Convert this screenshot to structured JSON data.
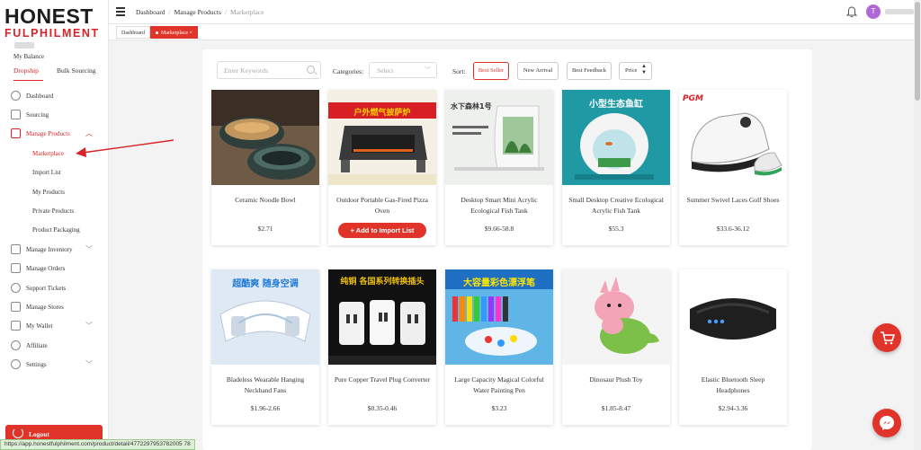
{
  "brand": {
    "line1": "HONEST",
    "line2": "FULPHILMENT"
  },
  "sidebar": {
    "balance_label": "My Balance",
    "tabs": [
      "Dropship",
      "Bulk Sourcing"
    ],
    "items": [
      {
        "label": "Dashboard",
        "icon": "dashboard-icon"
      },
      {
        "label": "Sourcing",
        "icon": "sourcing-icon"
      },
      {
        "label": "Manage Products",
        "icon": "products-icon"
      },
      {
        "label": "Manage Inventory",
        "icon": "inventory-icon"
      },
      {
        "label": "Manage Orders",
        "icon": "orders-icon"
      },
      {
        "label": "Support Tickets",
        "icon": "support-icon"
      },
      {
        "label": "Manage Stores",
        "icon": "stores-icon"
      },
      {
        "label": "My Wallet",
        "icon": "wallet-icon"
      },
      {
        "label": "Affiliate",
        "icon": "affiliate-icon"
      },
      {
        "label": "Settings",
        "icon": "settings-icon"
      }
    ],
    "subitems": [
      "Marketplace",
      "Import List",
      "My Products",
      "Private Products",
      "Product Packaging"
    ],
    "logout": "Logout"
  },
  "topbar": {
    "breadcrumbs": [
      "Dashboard",
      "Manage Products",
      "Marketplace"
    ],
    "avatar_initial": "T"
  },
  "page_tabs": [
    "Dashboard",
    "Marketplace"
  ],
  "filters": {
    "search_placeholder": "Enter Keywords",
    "categories_label": "Categories:",
    "categories_placeholder": "Select",
    "sort_label": "Sort:",
    "sort_options": [
      "Best Seller",
      "New Arrival",
      "Best Feedback",
      "Price"
    ],
    "active_sort": "Best Seller"
  },
  "products": [
    {
      "name": "Ceramic Noodle Bowl",
      "price": "$2.71"
    },
    {
      "name": "Outdoor Portable Gas-Fired Pizza Oven",
      "price": "",
      "banner": "户外燃气披萨炉"
    },
    {
      "name": "Desktop Smart Mini Acrylic Ecological Fish Tank",
      "price": "$9.66-58.8",
      "banner": "水下森林1号"
    },
    {
      "name": "Small Desktop Creative Ecological Acrylic Fish Tank",
      "price": "$55.3",
      "banner": "小型生态鱼缸"
    },
    {
      "name": "Summer Swivel Laces Golf Shoes",
      "price": "$33.6-36.12",
      "banner": "PGM"
    },
    {
      "name": "Bladeless Wearable Hanging Neckband Fans",
      "price": "$1.96-2.66",
      "banner": "超酷爽 随身空调"
    },
    {
      "name": "Pure Copper Travel Plug Converter",
      "price": "$0.35-0.46",
      "banner": "纯铜 各国系列转换插头"
    },
    {
      "name": "Large Capacity Magical Colorful Water Painting Pen",
      "price": "$3.23",
      "banner": "大容量彩色漂浮笔"
    },
    {
      "name": "Dinosaur Plush Toy",
      "price": "$1.85-8.47"
    },
    {
      "name": "Elastic Bluetooth Sleep Headphones",
      "price": "$2.94-3.36"
    }
  ],
  "add_button_label": "+ Add to Import List",
  "status_url": "https://app.honestfulphilment.com/product/detail/4772297953782005 78",
  "colors": {
    "accent": "#e0342a",
    "brand_red": "#d8232a"
  }
}
